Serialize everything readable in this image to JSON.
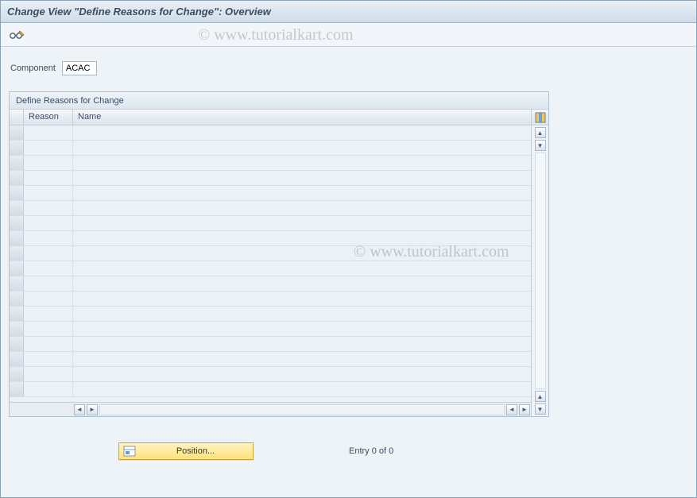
{
  "titlebar": {
    "title": "Change View \"Define Reasons for Change\": Overview"
  },
  "toolbar": {
    "glasses_icon": "display-change-toggle"
  },
  "watermark": {
    "text": "© www.tutorialkart.com"
  },
  "fields": {
    "component_label": "Component",
    "component_value": "ACAC"
  },
  "table": {
    "title": "Define Reasons for Change",
    "columns": {
      "reason": "Reason",
      "name": "Name"
    },
    "rows": [
      {
        "reason": "",
        "name": ""
      },
      {
        "reason": "",
        "name": ""
      },
      {
        "reason": "",
        "name": ""
      },
      {
        "reason": "",
        "name": ""
      },
      {
        "reason": "",
        "name": ""
      },
      {
        "reason": "",
        "name": ""
      },
      {
        "reason": "",
        "name": ""
      },
      {
        "reason": "",
        "name": ""
      },
      {
        "reason": "",
        "name": ""
      },
      {
        "reason": "",
        "name": ""
      },
      {
        "reason": "",
        "name": ""
      },
      {
        "reason": "",
        "name": ""
      },
      {
        "reason": "",
        "name": ""
      },
      {
        "reason": "",
        "name": ""
      },
      {
        "reason": "",
        "name": ""
      },
      {
        "reason": "",
        "name": ""
      },
      {
        "reason": "",
        "name": ""
      },
      {
        "reason": "",
        "name": ""
      }
    ]
  },
  "footer": {
    "position_label": "Position...",
    "entry_status": "Entry 0 of 0"
  },
  "colors": {
    "accent_yellow": "#ffe27a",
    "border": "#a8b6c2",
    "header_bg": "#dbe4ec"
  }
}
